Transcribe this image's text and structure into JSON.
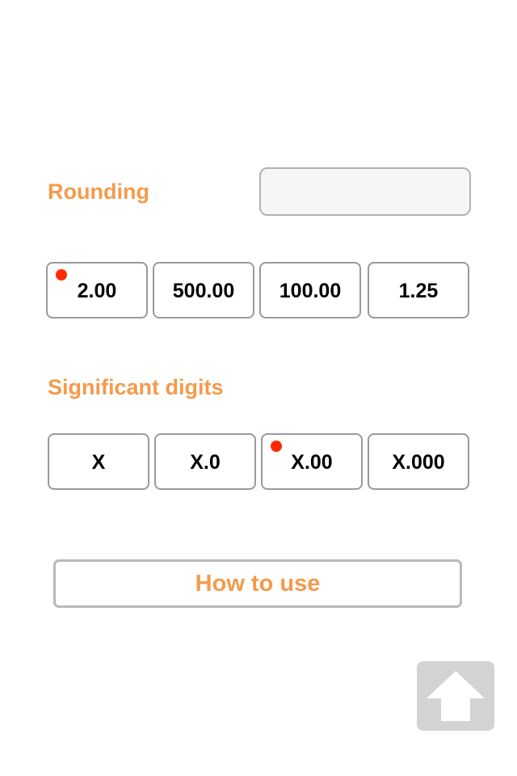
{
  "rounding": {
    "label": "Rounding",
    "input_value": "",
    "options": [
      {
        "label": "2.00",
        "selected": true
      },
      {
        "label": "500.00",
        "selected": false
      },
      {
        "label": "100.00",
        "selected": false
      },
      {
        "label": "1.25",
        "selected": false
      }
    ]
  },
  "significant_digits": {
    "label": "Significant digits",
    "options": [
      {
        "label": "X",
        "selected": false
      },
      {
        "label": "X.0",
        "selected": false
      },
      {
        "label": "X.00",
        "selected": true
      },
      {
        "label": "X.000",
        "selected": false
      }
    ]
  },
  "how_to_use": {
    "label": "How to use"
  },
  "scroll_top": {
    "icon": "arrow-up-icon"
  },
  "colors": {
    "accent": "#f49a4c",
    "selected_dot": "#ff2a00",
    "border": "#9a9a9a",
    "button_gray": "#d3d3d3"
  }
}
